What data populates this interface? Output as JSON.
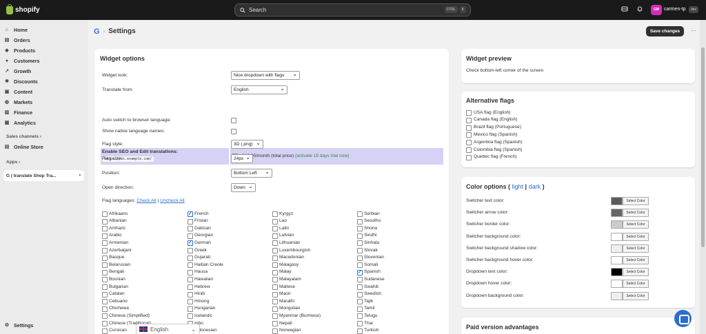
{
  "topbar": {
    "brand": "shopify",
    "search_label": "Search",
    "shortcut": [
      "CTRL",
      "K"
    ],
    "store_initials": "GM",
    "store_name": "carmen-tp",
    "store_badge": "dev"
  },
  "sidebar": {
    "items": [
      {
        "label": "Home",
        "icon": "home-icon"
      },
      {
        "label": "Orders",
        "icon": "orders-icon"
      },
      {
        "label": "Products",
        "icon": "tag-icon"
      },
      {
        "label": "Customers",
        "icon": "person-icon"
      },
      {
        "label": "Growth",
        "icon": "growth-icon"
      },
      {
        "label": "Discounts",
        "icon": "discount-icon"
      },
      {
        "label": "Content",
        "icon": "content-icon"
      },
      {
        "label": "Markets",
        "icon": "globe-icon"
      },
      {
        "label": "Finance",
        "icon": "bank-icon"
      },
      {
        "label": "Analytics",
        "icon": "chart-icon"
      }
    ],
    "sales_channels_title": "Sales channels",
    "online_store": "Online Store",
    "apps_title": "Apps",
    "app_item": "G | translate Shop Tra...",
    "settings": "Settings"
  },
  "page": {
    "app_logo": "G",
    "title": "Settings",
    "save_label": "Save changes",
    "more_label": "···"
  },
  "widget_options": {
    "title": "Widget options",
    "widget_look_label": "Widget look:",
    "widget_look_value": "Nice dropdown with flags",
    "translate_from_label": "Translate from:",
    "translate_from_value": "English",
    "seo_label": "Enable SEO and Edit translations:",
    "seo_example": "https://es.example.com/",
    "seo_price": "$12.00/month (total price)",
    "seo_trial": "(activate 15 days trial now)",
    "auto_switch_label": "Auto switch to browser language:",
    "native_names_label": "Show native language names:",
    "flag_style_label": "Flag style:",
    "flag_style_value": "3D (.png)",
    "flag_size_label": "Flag size:",
    "flag_size_value": "24px",
    "position_label": "Position:",
    "position_value": "Bottom Left",
    "open_direction_label": "Open direction:",
    "open_direction_value": "Down",
    "flag_languages_label": "Flag languages:",
    "check_all": "Check All",
    "divider": "|",
    "uncheck_all": "Uncheck All",
    "languages": [
      [
        {
          "name": "Afrikaans",
          "checked": false
        },
        {
          "name": "Albanian",
          "checked": false
        },
        {
          "name": "Amharic",
          "checked": false
        },
        {
          "name": "Arabic",
          "checked": false
        },
        {
          "name": "Armenian",
          "checked": false
        },
        {
          "name": "Azerbaijani",
          "checked": false
        },
        {
          "name": "Basque",
          "checked": false
        },
        {
          "name": "Belarusian",
          "checked": false
        },
        {
          "name": "Bengali",
          "checked": false
        },
        {
          "name": "Bosnian",
          "checked": false
        },
        {
          "name": "Bulgarian",
          "checked": false
        },
        {
          "name": "Catalan",
          "checked": false
        },
        {
          "name": "Cebuano",
          "checked": false
        },
        {
          "name": "Chichewa",
          "checked": false
        },
        {
          "name": "Chinese (Simplified)",
          "checked": false
        },
        {
          "name": "Chinese (Traditional)",
          "checked": false
        },
        {
          "name": "Corsican",
          "checked": false
        }
      ],
      [
        {
          "name": "French",
          "checked": true
        },
        {
          "name": "Frisian",
          "checked": false
        },
        {
          "name": "Galician",
          "checked": false
        },
        {
          "name": "Georgian",
          "checked": false
        },
        {
          "name": "German",
          "checked": true
        },
        {
          "name": "Greek",
          "checked": false
        },
        {
          "name": "Gujarati",
          "checked": false
        },
        {
          "name": "Haitian Creole",
          "checked": false
        },
        {
          "name": "Hausa",
          "checked": false
        },
        {
          "name": "Hawaiian",
          "checked": false
        },
        {
          "name": "Hebrew",
          "checked": false
        },
        {
          "name": "Hindi",
          "checked": false
        },
        {
          "name": "Hmong",
          "checked": false
        },
        {
          "name": "Hungarian",
          "checked": false
        },
        {
          "name": "Icelandic",
          "checked": false
        },
        {
          "name": "Igbo",
          "checked": false
        },
        {
          "name": "Indonesian",
          "checked": false
        }
      ],
      [
        {
          "name": "Kyrgyz",
          "checked": false
        },
        {
          "name": "Lao",
          "checked": false
        },
        {
          "name": "Latin",
          "checked": false
        },
        {
          "name": "Latvian",
          "checked": false
        },
        {
          "name": "Lithuanian",
          "checked": false
        },
        {
          "name": "Luxembourgish",
          "checked": false
        },
        {
          "name": "Macedonian",
          "checked": false
        },
        {
          "name": "Malagasy",
          "checked": false
        },
        {
          "name": "Malay",
          "checked": false
        },
        {
          "name": "Malayalam",
          "checked": false
        },
        {
          "name": "Maltese",
          "checked": false
        },
        {
          "name": "Maori",
          "checked": false
        },
        {
          "name": "Marathi",
          "checked": false
        },
        {
          "name": "Mongolian",
          "checked": false
        },
        {
          "name": "Myanmar (Burmese)",
          "checked": false
        },
        {
          "name": "Nepali",
          "checked": false
        },
        {
          "name": "Norwegian",
          "checked": false
        }
      ],
      [
        {
          "name": "Serbian",
          "checked": false
        },
        {
          "name": "Sesotho",
          "checked": false
        },
        {
          "name": "Shona",
          "checked": false
        },
        {
          "name": "Sindhi",
          "checked": false
        },
        {
          "name": "Sinhala",
          "checked": false
        },
        {
          "name": "Slovak",
          "checked": false
        },
        {
          "name": "Slovenian",
          "checked": false
        },
        {
          "name": "Somali",
          "checked": false
        },
        {
          "name": "Spanish",
          "checked": true
        },
        {
          "name": "Sudanese",
          "checked": false
        },
        {
          "name": "Swahili",
          "checked": false
        },
        {
          "name": "Swedish",
          "checked": false
        },
        {
          "name": "Tajik",
          "checked": false
        },
        {
          "name": "Tamil",
          "checked": false
        },
        {
          "name": "Telugu",
          "checked": false
        },
        {
          "name": "Thai",
          "checked": false
        },
        {
          "name": "Turkish",
          "checked": false
        }
      ]
    ]
  },
  "widget_preview": {
    "title": "Widget preview",
    "text": "Check bottom-left corner of the screen"
  },
  "alt_flags": {
    "title": "Alternative flags",
    "items": [
      "USA flag (English)",
      "Canada flag (English)",
      "Brazil flag (Portuguese)",
      "Mexico flag (Spanish)",
      "Argentina flag (Spanish)",
      "Colombia flag (Spanish)",
      "Quebec flag (French)"
    ]
  },
  "color_options": {
    "title": "Color options (",
    "light": "light",
    "sep": "|",
    "dark": "dark",
    "close": ")",
    "button_label": "Select Color",
    "rows": [
      {
        "label": "Switcher text color:",
        "color": "#5b5b5b"
      },
      {
        "label": "Switcher arrow color:",
        "color": "#666666"
      },
      {
        "label": "Switcher border color:",
        "color": "#cccccc"
      },
      {
        "label": "Switcher background color:",
        "color": "#ffffff"
      },
      {
        "label": "Switcher background shadow color:",
        "color": "#efefef"
      },
      {
        "label": "Switcher background hover color:",
        "color": "#ffffff"
      },
      {
        "label": "Dropdown text color:",
        "color": "#000000"
      },
      {
        "label": "Dropdown hover color:",
        "color": "#ffffff"
      },
      {
        "label": "Dropdown background color:",
        "color": "#eeeeee"
      }
    ]
  },
  "paid": {
    "title": "Paid version advantages"
  },
  "lang_switcher": {
    "value": "English"
  }
}
